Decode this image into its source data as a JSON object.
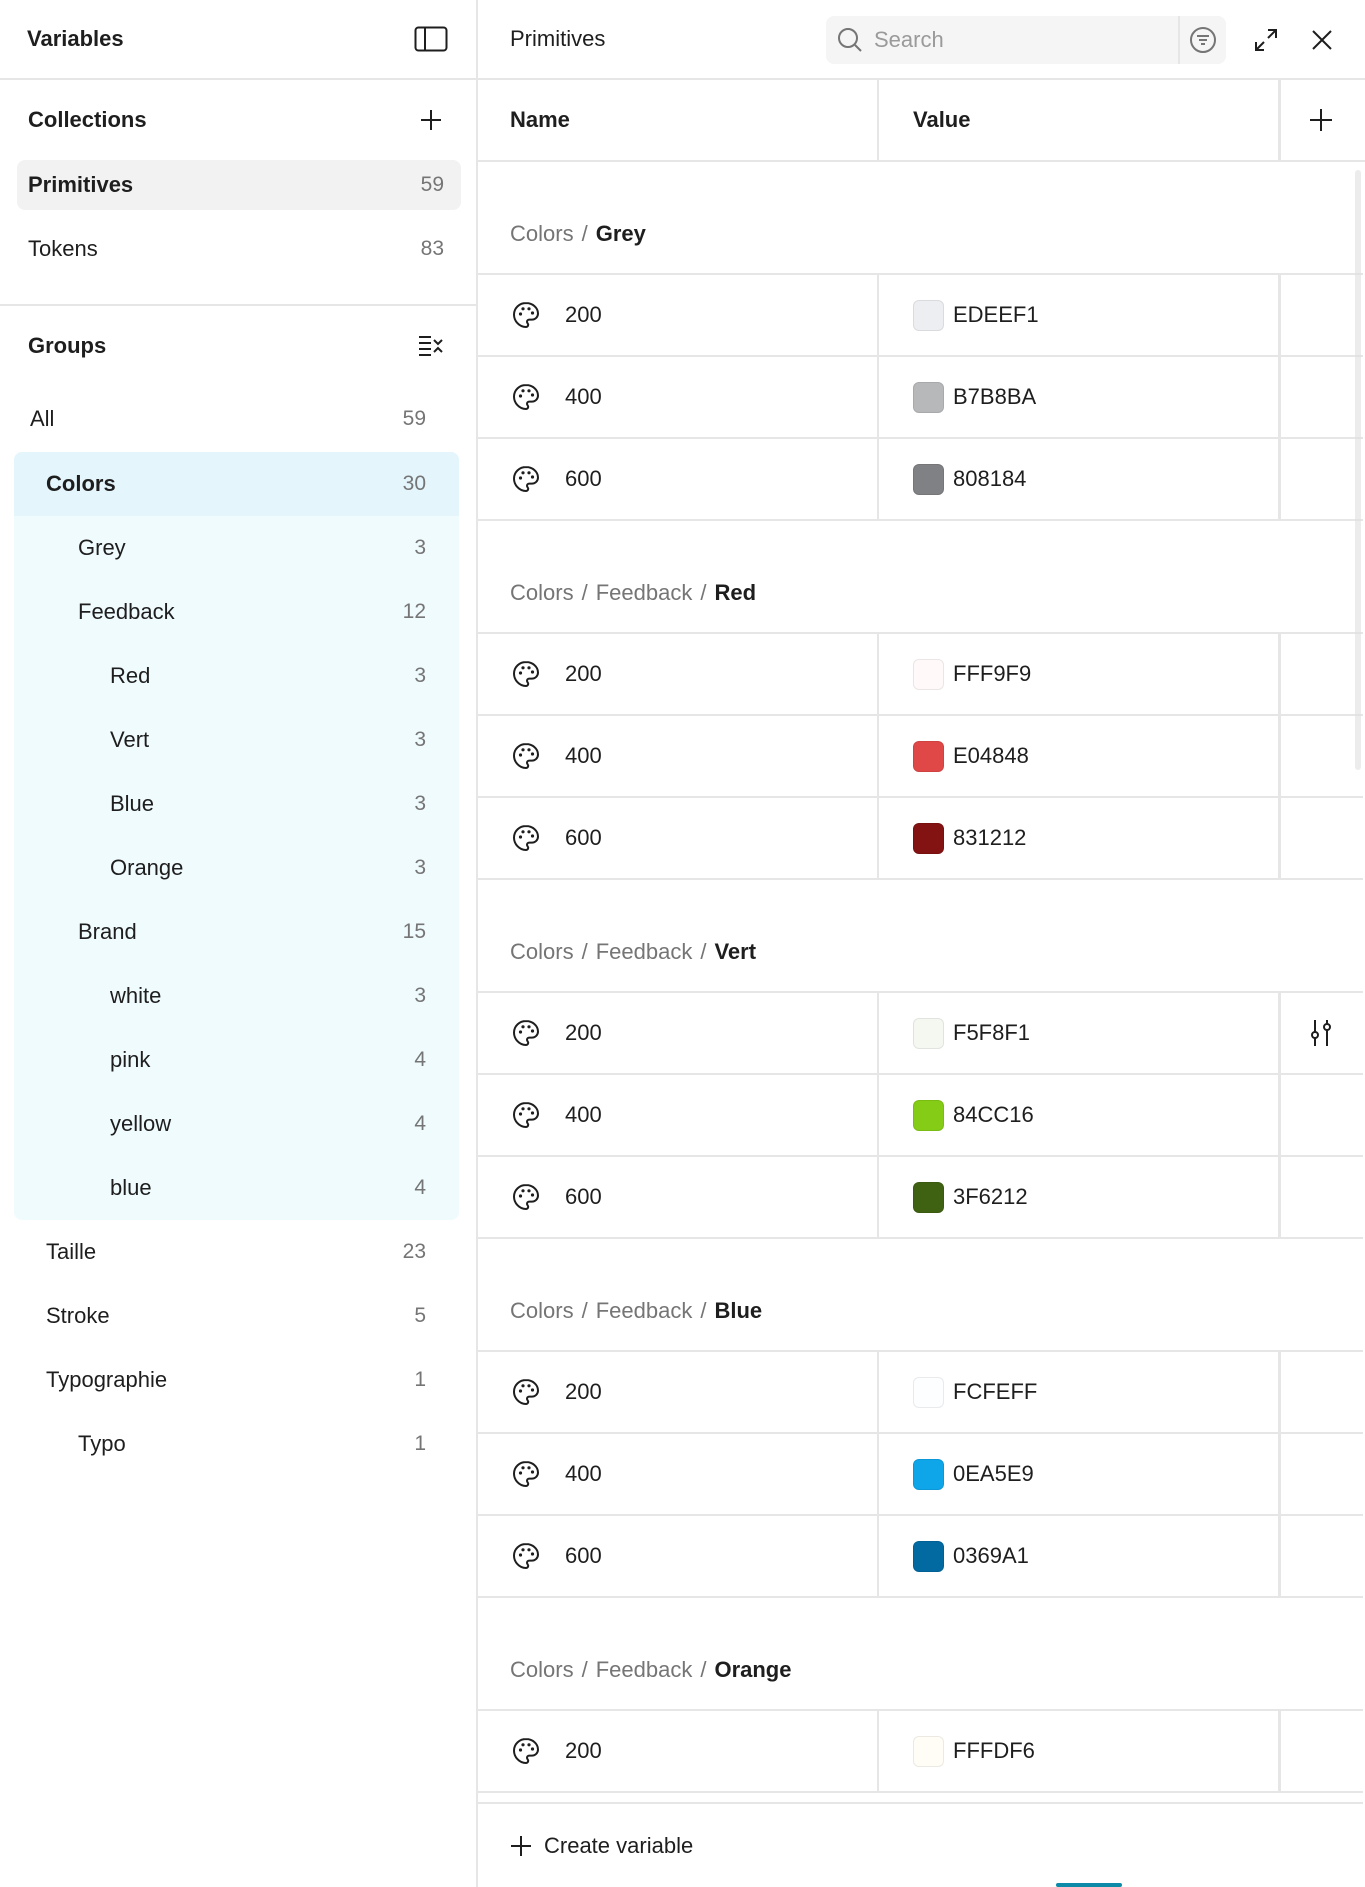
{
  "sidebar": {
    "title": "Variables",
    "collections": {
      "title": "Collections",
      "items": [
        {
          "label": "Primitives",
          "count": "59"
        },
        {
          "label": "Tokens",
          "count": "83"
        }
      ]
    },
    "groups": {
      "title": "Groups",
      "all": {
        "label": "All",
        "count": "59"
      },
      "colors": {
        "label": "Colors",
        "count": "30"
      },
      "grey": {
        "label": "Grey",
        "count": "3"
      },
      "feedback": {
        "label": "Feedback",
        "count": "12"
      },
      "red": {
        "label": "Red",
        "count": "3"
      },
      "vert": {
        "label": "Vert",
        "count": "3"
      },
      "blue": {
        "label": "Blue",
        "count": "3"
      },
      "orange": {
        "label": "Orange",
        "count": "3"
      },
      "brand": {
        "label": "Brand",
        "count": "15"
      },
      "white": {
        "label": "white",
        "count": "3"
      },
      "pink": {
        "label": "pink",
        "count": "4"
      },
      "yellow": {
        "label": "yellow",
        "count": "4"
      },
      "brand_blue": {
        "label": "blue",
        "count": "4"
      },
      "taille": {
        "label": "Taille",
        "count": "23"
      },
      "stroke": {
        "label": "Stroke",
        "count": "5"
      },
      "typographie": {
        "label": "Typographie",
        "count": "1"
      },
      "typo": {
        "label": "Typo",
        "count": "1"
      }
    }
  },
  "main": {
    "title": "Primitives",
    "search_placeholder": "Search",
    "columns": {
      "name": "Name",
      "value": "Value"
    },
    "separator": "/",
    "groups": [
      {
        "path": [
          "Colors"
        ],
        "leaf": "Grey",
        "rows": [
          {
            "name": "200",
            "value": "EDEEF1",
            "color": "#EDEEF1"
          },
          {
            "name": "400",
            "value": "B7B8BA",
            "color": "#B7B8BA"
          },
          {
            "name": "600",
            "value": "808184",
            "color": "#808184"
          }
        ]
      },
      {
        "path": [
          "Colors",
          "Feedback"
        ],
        "leaf": "Red",
        "rows": [
          {
            "name": "200",
            "value": "FFF9F9",
            "color": "#FFF9F9"
          },
          {
            "name": "400",
            "value": "E04848",
            "color": "#E04848"
          },
          {
            "name": "600",
            "value": "831212",
            "color": "#831212"
          }
        ]
      },
      {
        "path": [
          "Colors",
          "Feedback"
        ],
        "leaf": "Vert",
        "rows": [
          {
            "name": "200",
            "value": "F5F8F1",
            "color": "#F5F8F1"
          },
          {
            "name": "400",
            "value": "84CC16",
            "color": "#84CC16"
          },
          {
            "name": "600",
            "value": "3F6212",
            "color": "#3F6212"
          }
        ]
      },
      {
        "path": [
          "Colors",
          "Feedback"
        ],
        "leaf": "Blue",
        "rows": [
          {
            "name": "200",
            "value": "FCFEFF",
            "color": "#FCFEFF"
          },
          {
            "name": "400",
            "value": "0EA5E9",
            "color": "#0EA5E9"
          },
          {
            "name": "600",
            "value": "0369A1",
            "color": "#0369A1"
          }
        ]
      },
      {
        "path": [
          "Colors",
          "Feedback"
        ],
        "leaf": "Orange",
        "rows": [
          {
            "name": "200",
            "value": "FFFDF6",
            "color": "#FFFDF6"
          }
        ]
      }
    ],
    "footer": {
      "create_label": "Create variable"
    }
  },
  "colors": {
    "selected_group_bg": "#E4F5FC",
    "group_tint_bg": "#F0FBFE",
    "accent": "#0D8AA8"
  },
  "icons": {
    "row_icon": "palette-icon",
    "hover_action": "sliders-icon"
  }
}
